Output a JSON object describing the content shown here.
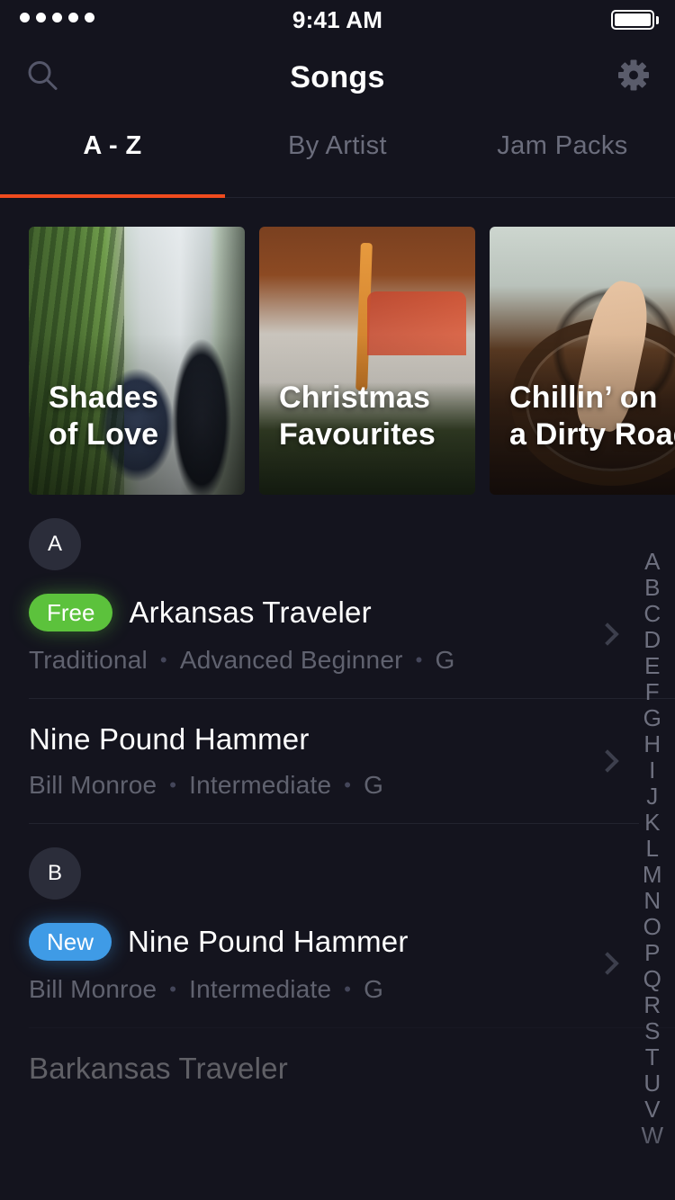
{
  "colors": {
    "background": "#14141e",
    "accent_orange": "#ef4b1e",
    "badge_free_green": "#5cc23c",
    "badge_new_blue": "#3f9be6",
    "letter_circle": "#2b2d3a",
    "muted_text": "#60626f"
  },
  "status_bar": {
    "signal_dots": 5,
    "time": "9:41 AM",
    "battery_icon": "battery-full-icon"
  },
  "header": {
    "title": "Songs",
    "search_icon": "search-icon",
    "settings_icon": "gear-icon"
  },
  "tabs": [
    {
      "label": "A - Z",
      "active": true
    },
    {
      "label": "By Artist",
      "active": false
    },
    {
      "label": "Jam Packs",
      "active": false
    }
  ],
  "carousel": {
    "cards": [
      {
        "title": "Shades\nof Love",
        "art": "couple-holding-hands-sidewalk"
      },
      {
        "title": "Christmas\nFavourites",
        "art": "candle-with-pine-branches"
      },
      {
        "title": "Chillin’ on\na Dirty Road",
        "art": "hand-on-steering-wheel"
      }
    ]
  },
  "sections": [
    {
      "letter": "A",
      "songs": [
        {
          "badge": "Free",
          "badge_type": "free",
          "title": "Arkansas Traveler",
          "artist": "Traditional",
          "difficulty": "Advanced Beginner",
          "key": "G",
          "chevron": "chevron-right-icon"
        },
        {
          "badge": null,
          "badge_type": null,
          "title": "Nine Pound Hammer",
          "artist": "Bill Monroe",
          "difficulty": "Intermediate",
          "key": "G",
          "chevron": "chevron-right-icon"
        }
      ]
    },
    {
      "letter": "B",
      "songs": [
        {
          "badge": "New",
          "badge_type": "new",
          "title": "Nine Pound Hammer",
          "artist": "Bill Monroe",
          "difficulty": "Intermediate",
          "key": "G",
          "chevron": "chevron-right-icon"
        },
        {
          "badge": null,
          "badge_type": null,
          "title": "Barkansas Traveler",
          "artist": "",
          "difficulty": "",
          "key": "",
          "chevron": "chevron-right-icon"
        }
      ]
    }
  ],
  "alpha_index": [
    "A",
    "B",
    "C",
    "D",
    "E",
    "F",
    "G",
    "H",
    "I",
    "J",
    "K",
    "L",
    "M",
    "N",
    "O",
    "P",
    "Q",
    "R",
    "S",
    "T",
    "U",
    "V",
    "W"
  ],
  "separator": "•"
}
